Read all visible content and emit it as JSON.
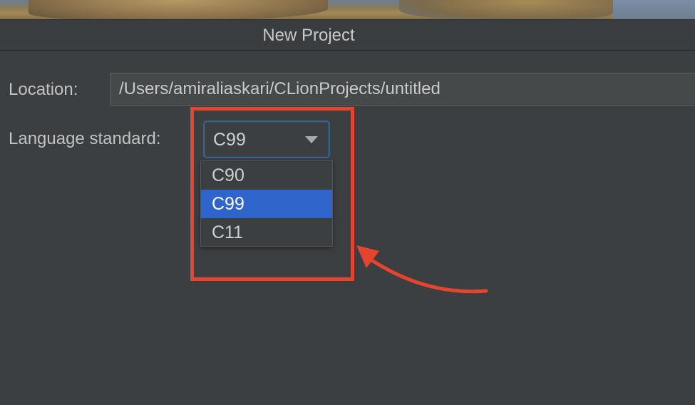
{
  "window": {
    "title": "New Project"
  },
  "form": {
    "location_label": "Location:",
    "location_value": "/Users/amiraliaskari/CLionProjects/untitled",
    "language_label": "Language standard:",
    "language_selected": "C99",
    "language_options": [
      "C90",
      "C99",
      "C11"
    ],
    "language_highlighted": "C99"
  },
  "annotation": {
    "color": "#e5452f"
  },
  "colors": {
    "background": "#3c3f41",
    "selection": "#2f65ca",
    "focus_border": "#3d6185"
  }
}
